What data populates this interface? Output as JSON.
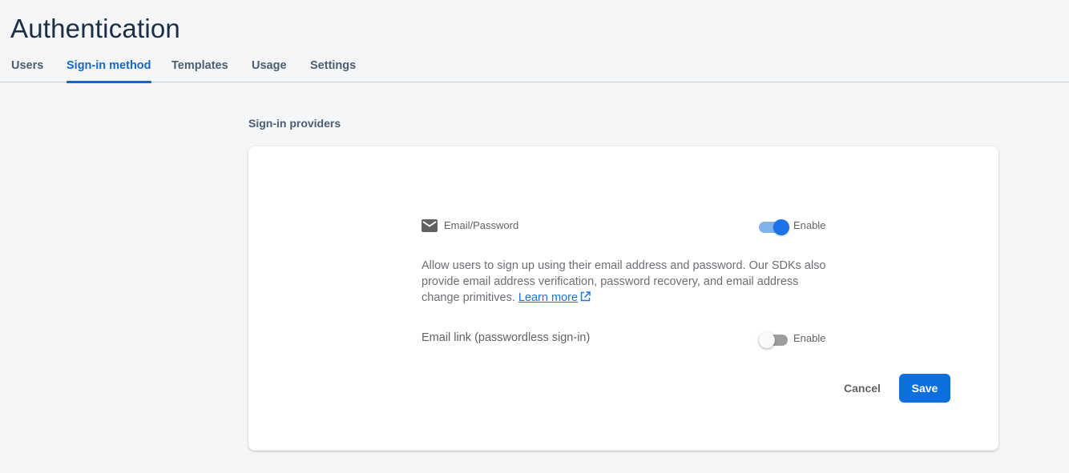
{
  "header": {
    "title": "Authentication"
  },
  "tabs": [
    {
      "label": "Users",
      "active": false
    },
    {
      "label": "Sign-in method",
      "active": true
    },
    {
      "label": "Templates",
      "active": false
    },
    {
      "label": "Usage",
      "active": false
    },
    {
      "label": "Settings",
      "active": false
    }
  ],
  "section": {
    "label": "Sign-in providers"
  },
  "providers": {
    "email_password": {
      "icon": "mail-icon",
      "label": "Email/Password",
      "toggle_label": "Enable",
      "enabled": true,
      "description": "Allow users to sign up using their email address and password. Our SDKs also provide email address verification, password recovery, and email address change primitives.",
      "learn_more": "Learn more",
      "learn_more_icon": "external-link-icon"
    },
    "email_link": {
      "label": "Email link (passwordless sign-in)",
      "toggle_label": "Enable",
      "enabled": false
    }
  },
  "actions": {
    "cancel_label": "Cancel",
    "save_label": "Save"
  },
  "colors": {
    "accent": "#1a73e8",
    "primary_button": "#0b6fde",
    "active_tab": "#1567c5",
    "title": "#1a2f45",
    "background": "#f5f6f8"
  }
}
